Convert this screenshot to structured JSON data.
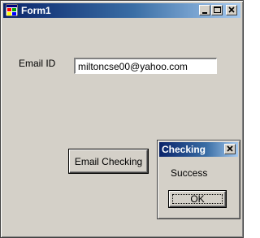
{
  "window": {
    "title": "Form1",
    "icon": "windows-form-icon",
    "controls": [
      "minimize-icon",
      "maximize-icon",
      "close-icon"
    ]
  },
  "form": {
    "email_label": "Email ID",
    "email_value": "miltoncse00@yahoo.com",
    "email_placeholder": "",
    "check_button_label": "Email Checking"
  },
  "dialog": {
    "title": "Checking",
    "message": "Success",
    "ok_label": "OK",
    "close_icon": "close-icon"
  },
  "colors": {
    "window_bg": "#d4d0c8",
    "titlebar_start": "#0a246a",
    "titlebar_end": "#a6caf0",
    "title_text": "#ffffff"
  }
}
